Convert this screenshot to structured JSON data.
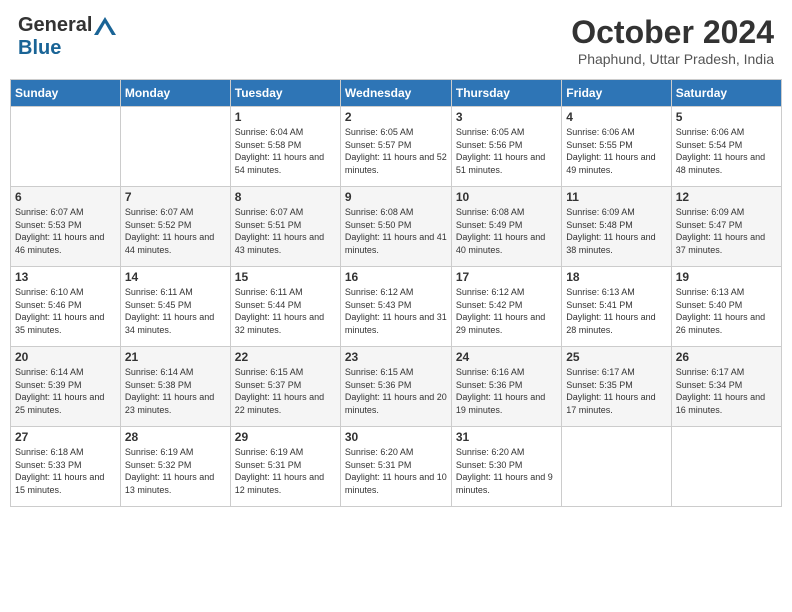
{
  "header": {
    "logo_general": "General",
    "logo_blue": "Blue",
    "month_title": "October 2024",
    "subtitle": "Phaphund, Uttar Pradesh, India"
  },
  "days_of_week": [
    "Sunday",
    "Monday",
    "Tuesday",
    "Wednesday",
    "Thursday",
    "Friday",
    "Saturday"
  ],
  "weeks": [
    [
      {
        "day": "",
        "sunrise": "",
        "sunset": "",
        "daylight": ""
      },
      {
        "day": "",
        "sunrise": "",
        "sunset": "",
        "daylight": ""
      },
      {
        "day": "1",
        "sunrise": "Sunrise: 6:04 AM",
        "sunset": "Sunset: 5:58 PM",
        "daylight": "Daylight: 11 hours and 54 minutes."
      },
      {
        "day": "2",
        "sunrise": "Sunrise: 6:05 AM",
        "sunset": "Sunset: 5:57 PM",
        "daylight": "Daylight: 11 hours and 52 minutes."
      },
      {
        "day": "3",
        "sunrise": "Sunrise: 6:05 AM",
        "sunset": "Sunset: 5:56 PM",
        "daylight": "Daylight: 11 hours and 51 minutes."
      },
      {
        "day": "4",
        "sunrise": "Sunrise: 6:06 AM",
        "sunset": "Sunset: 5:55 PM",
        "daylight": "Daylight: 11 hours and 49 minutes."
      },
      {
        "day": "5",
        "sunrise": "Sunrise: 6:06 AM",
        "sunset": "Sunset: 5:54 PM",
        "daylight": "Daylight: 11 hours and 48 minutes."
      }
    ],
    [
      {
        "day": "6",
        "sunrise": "Sunrise: 6:07 AM",
        "sunset": "Sunset: 5:53 PM",
        "daylight": "Daylight: 11 hours and 46 minutes."
      },
      {
        "day": "7",
        "sunrise": "Sunrise: 6:07 AM",
        "sunset": "Sunset: 5:52 PM",
        "daylight": "Daylight: 11 hours and 44 minutes."
      },
      {
        "day": "8",
        "sunrise": "Sunrise: 6:07 AM",
        "sunset": "Sunset: 5:51 PM",
        "daylight": "Daylight: 11 hours and 43 minutes."
      },
      {
        "day": "9",
        "sunrise": "Sunrise: 6:08 AM",
        "sunset": "Sunset: 5:50 PM",
        "daylight": "Daylight: 11 hours and 41 minutes."
      },
      {
        "day": "10",
        "sunrise": "Sunrise: 6:08 AM",
        "sunset": "Sunset: 5:49 PM",
        "daylight": "Daylight: 11 hours and 40 minutes."
      },
      {
        "day": "11",
        "sunrise": "Sunrise: 6:09 AM",
        "sunset": "Sunset: 5:48 PM",
        "daylight": "Daylight: 11 hours and 38 minutes."
      },
      {
        "day": "12",
        "sunrise": "Sunrise: 6:09 AM",
        "sunset": "Sunset: 5:47 PM",
        "daylight": "Daylight: 11 hours and 37 minutes."
      }
    ],
    [
      {
        "day": "13",
        "sunrise": "Sunrise: 6:10 AM",
        "sunset": "Sunset: 5:46 PM",
        "daylight": "Daylight: 11 hours and 35 minutes."
      },
      {
        "day": "14",
        "sunrise": "Sunrise: 6:11 AM",
        "sunset": "Sunset: 5:45 PM",
        "daylight": "Daylight: 11 hours and 34 minutes."
      },
      {
        "day": "15",
        "sunrise": "Sunrise: 6:11 AM",
        "sunset": "Sunset: 5:44 PM",
        "daylight": "Daylight: 11 hours and 32 minutes."
      },
      {
        "day": "16",
        "sunrise": "Sunrise: 6:12 AM",
        "sunset": "Sunset: 5:43 PM",
        "daylight": "Daylight: 11 hours and 31 minutes."
      },
      {
        "day": "17",
        "sunrise": "Sunrise: 6:12 AM",
        "sunset": "Sunset: 5:42 PM",
        "daylight": "Daylight: 11 hours and 29 minutes."
      },
      {
        "day": "18",
        "sunrise": "Sunrise: 6:13 AM",
        "sunset": "Sunset: 5:41 PM",
        "daylight": "Daylight: 11 hours and 28 minutes."
      },
      {
        "day": "19",
        "sunrise": "Sunrise: 6:13 AM",
        "sunset": "Sunset: 5:40 PM",
        "daylight": "Daylight: 11 hours and 26 minutes."
      }
    ],
    [
      {
        "day": "20",
        "sunrise": "Sunrise: 6:14 AM",
        "sunset": "Sunset: 5:39 PM",
        "daylight": "Daylight: 11 hours and 25 minutes."
      },
      {
        "day": "21",
        "sunrise": "Sunrise: 6:14 AM",
        "sunset": "Sunset: 5:38 PM",
        "daylight": "Daylight: 11 hours and 23 minutes."
      },
      {
        "day": "22",
        "sunrise": "Sunrise: 6:15 AM",
        "sunset": "Sunset: 5:37 PM",
        "daylight": "Daylight: 11 hours and 22 minutes."
      },
      {
        "day": "23",
        "sunrise": "Sunrise: 6:15 AM",
        "sunset": "Sunset: 5:36 PM",
        "daylight": "Daylight: 11 hours and 20 minutes."
      },
      {
        "day": "24",
        "sunrise": "Sunrise: 6:16 AM",
        "sunset": "Sunset: 5:36 PM",
        "daylight": "Daylight: 11 hours and 19 minutes."
      },
      {
        "day": "25",
        "sunrise": "Sunrise: 6:17 AM",
        "sunset": "Sunset: 5:35 PM",
        "daylight": "Daylight: 11 hours and 17 minutes."
      },
      {
        "day": "26",
        "sunrise": "Sunrise: 6:17 AM",
        "sunset": "Sunset: 5:34 PM",
        "daylight": "Daylight: 11 hours and 16 minutes."
      }
    ],
    [
      {
        "day": "27",
        "sunrise": "Sunrise: 6:18 AM",
        "sunset": "Sunset: 5:33 PM",
        "daylight": "Daylight: 11 hours and 15 minutes."
      },
      {
        "day": "28",
        "sunrise": "Sunrise: 6:19 AM",
        "sunset": "Sunset: 5:32 PM",
        "daylight": "Daylight: 11 hours and 13 minutes."
      },
      {
        "day": "29",
        "sunrise": "Sunrise: 6:19 AM",
        "sunset": "Sunset: 5:31 PM",
        "daylight": "Daylight: 11 hours and 12 minutes."
      },
      {
        "day": "30",
        "sunrise": "Sunrise: 6:20 AM",
        "sunset": "Sunset: 5:31 PM",
        "daylight": "Daylight: 11 hours and 10 minutes."
      },
      {
        "day": "31",
        "sunrise": "Sunrise: 6:20 AM",
        "sunset": "Sunset: 5:30 PM",
        "daylight": "Daylight: 11 hours and 9 minutes."
      },
      {
        "day": "",
        "sunrise": "",
        "sunset": "",
        "daylight": ""
      },
      {
        "day": "",
        "sunrise": "",
        "sunset": "",
        "daylight": ""
      }
    ]
  ]
}
